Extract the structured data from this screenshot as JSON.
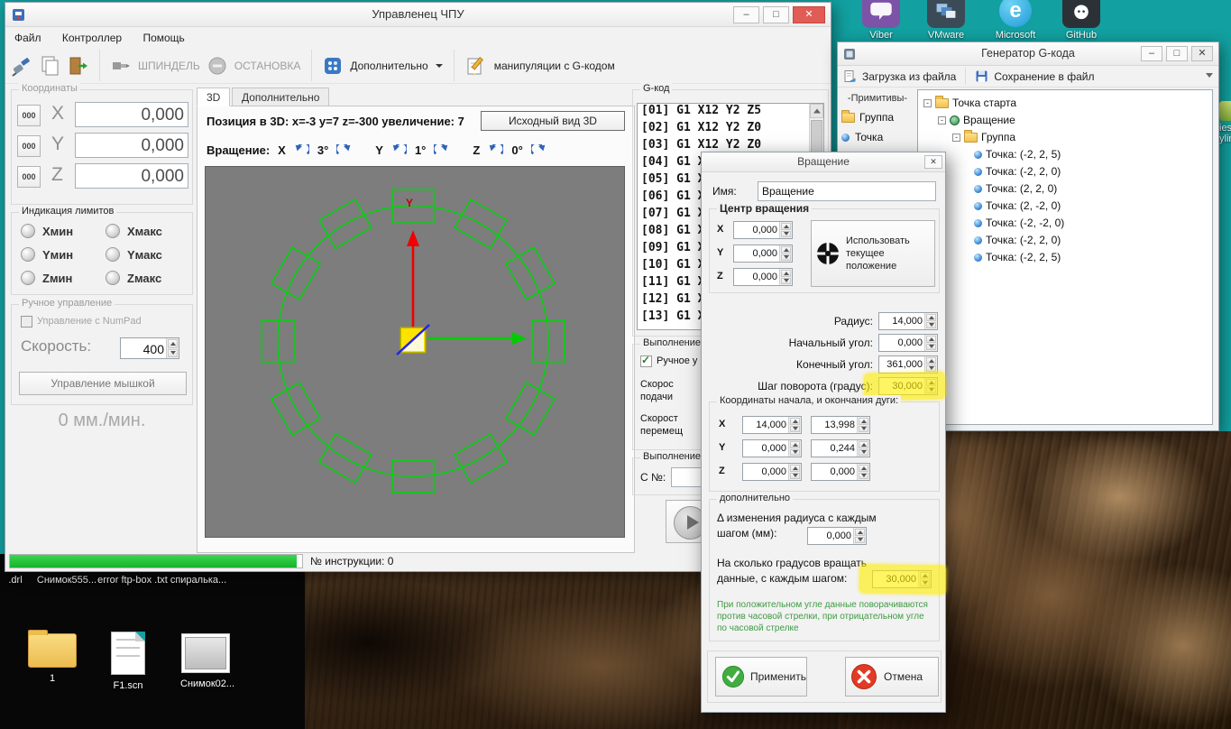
{
  "colors": {
    "highlight": "#fff200",
    "progress_green": "#1fc32a",
    "wireframe_green": "#00d60a",
    "axis_y_red": "#f00000",
    "axis_x_green": "#00cc00",
    "note_green": "#3f9b43",
    "desktop_teal": "#12a0a0"
  },
  "desktop": {
    "icons_top": [
      "Viber",
      "VMware",
      "Microsoft",
      "GitHub"
    ],
    "edge_label_1": "ies",
    "edge_label_2": "ylin...",
    "labels_row1": [
      ".drl",
      "Снимок555...",
      "error ftp-box .txt",
      "спиралька..."
    ],
    "icons_bottom": [
      "1",
      "F1.scn",
      "Снимок02..."
    ]
  },
  "main": {
    "title": "Управленец ЧПУ",
    "menu": [
      "Файл",
      "Контроллер",
      "Помощь"
    ],
    "toolbar": {
      "spindle": "ШПИНДЕЛЬ",
      "stop": "ОСТАНОВКА",
      "additional": "Дополнительно",
      "gcode": "манипуляции с G-кодом"
    },
    "coords": {
      "title": "Координаты",
      "zero": "000",
      "axes": [
        "X",
        "Y",
        "Z"
      ],
      "values": [
        "0,000",
        "0,000",
        "0,000"
      ]
    },
    "limits": {
      "title": "Индикация лимитов",
      "left": [
        "Хмин",
        "Yмин",
        "Zмин"
      ],
      "right": [
        "Хмакс",
        "Yмакс",
        "Zмакс"
      ]
    },
    "manual": {
      "title": "Ручное управление",
      "numpad": "Управление с NumPad",
      "speed_label": "Скорость:",
      "speed": "400",
      "mouse": "Управление мышкой",
      "feed": "0 мм./мин."
    },
    "tabs": [
      "3D",
      "Дополнительно"
    ],
    "view": {
      "info": "Позиция в 3D: x=-3 y=7 z=-300 увеличение: 7",
      "reset": "Исходный вид 3D",
      "rot_label": "Вращение:",
      "rot": [
        {
          "axis": "X",
          "angle": "3°"
        },
        {
          "axis": "Y",
          "angle": "1°"
        },
        {
          "axis": "Z",
          "angle": "0°"
        }
      ],
      "y_label": "Y"
    },
    "gcode": {
      "title": "G-код",
      "lines": [
        "[01] G1 X12 Y2 Z5",
        "[02] G1 X12 Y2 Z0",
        "[03] G1 X12 Y2 Z0",
        "[04] G1 X",
        "[05] G1 X",
        "[06] G1 X",
        "[07] G1 X",
        "[08] G1 X",
        "[09] G1 X",
        "[10] G1 X",
        "[11] G1 X",
        "[12] G1 X",
        "[13] G1 X"
      ]
    },
    "exec": {
      "title": "Выполнение",
      "manual": "Ручное у",
      "feed_a": "Скорос",
      "feed_b": "подачи",
      "move_a": "Скорост",
      "move_b": "перемещ",
      "title2": "Выполнение",
      "from": "С №:"
    },
    "status": "№ инструкции: 0"
  },
  "gen": {
    "title": "Генератор G-кода",
    "load": "Загрузка из файла",
    "save": "Сохранение в файл",
    "prim_title": "-Примитивы-",
    "prim": [
      "Группа",
      "Точка"
    ],
    "tree": [
      "Точка старта",
      "Вращение",
      "Группа",
      "Точка: (-2, 2, 5)",
      "Точка: (-2, 2, 0)",
      "Точка: (2, 2, 0)",
      "Точка: (2, -2, 0)",
      "Точка: (-2, -2, 0)",
      "Точка: (-2, 2, 0)",
      "Точка: (-2, 2, 5)"
    ]
  },
  "dlg": {
    "title": "Вращение",
    "name_label": "Имя:",
    "name": "Вращение",
    "center_title": "Центр вращения",
    "axes": [
      "X",
      "Y",
      "Z"
    ],
    "center": [
      "0,000",
      "0,000",
      "0,000"
    ],
    "use_current": "Использовать текущее положение",
    "radius_label": "Радиус:",
    "radius": "14,000",
    "start_label": "Начальный угол:",
    "start": "0,000",
    "end_label": "Конечный угол:",
    "end": "361,000",
    "step_label": "Шаг поворота (градус):",
    "step": "30,000",
    "arc_title": "Координаты начала, и окончания дуги:",
    "arc_x": [
      "14,000",
      "13,998"
    ],
    "arc_y": [
      "0,000",
      "0,244"
    ],
    "arc_z": [
      "0,000",
      "0,000"
    ],
    "extra_title": "дополнительно",
    "delta_label": "Δ изменения радиуса с каждым шагом (мм):",
    "delta": "0,000",
    "per_step_label": "На сколько градусов вращать данные, с каждым шагом:",
    "per_step": "30,000",
    "note": "При положительном угле данные поворачиваются против часовой стрелки, при отрицательном угле по часовой стрелке",
    "apply": "Применить",
    "cancel": "Отмена"
  }
}
